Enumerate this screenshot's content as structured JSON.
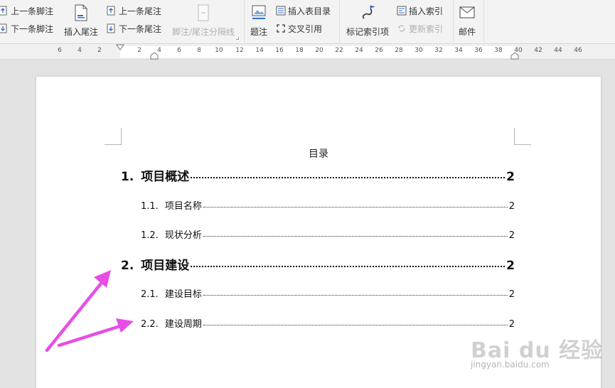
{
  "ribbon": {
    "footnote_prev": "上一条脚注",
    "footnote_next": "下一条脚注",
    "insert_endnote": "插入尾注",
    "endnote_prev": "上一条尾注",
    "endnote_next": "下一条尾注",
    "separator": "脚注/尾注分隔线",
    "caption": "题注",
    "insert_table_of_figures": "插入表目录",
    "cross_reference": "交叉引用",
    "mark_index_entry": "标记索引项",
    "insert_index": "插入索引",
    "update_index": "更新索引",
    "mail": "邮件"
  },
  "ruler": {
    "ticks": [
      "6",
      "4",
      "2",
      "2",
      "4",
      "6",
      "8",
      "10",
      "12",
      "14",
      "16",
      "18",
      "20",
      "22",
      "24",
      "26",
      "28",
      "30",
      "32",
      "34",
      "36",
      "38",
      "40",
      "42",
      "44",
      "46"
    ]
  },
  "document": {
    "toc_title": "目录",
    "entries": [
      {
        "number": "1.",
        "text": "项目概述",
        "page": "2",
        "level": 1
      },
      {
        "number": "1.1.",
        "text": "项目名称",
        "page": "2",
        "level": 2
      },
      {
        "number": "1.2.",
        "text": "现状分析",
        "page": "2",
        "level": 2
      },
      {
        "number": "2.",
        "text": "项目建设",
        "page": "2",
        "level": 1
      },
      {
        "number": "2.1.",
        "text": "建设目标",
        "page": "2",
        "level": 2
      },
      {
        "number": "2.2.",
        "text": "建设周期",
        "page": "2",
        "level": 2
      }
    ]
  },
  "annotation": {
    "arrow_color": "#e64ee6"
  },
  "watermark": {
    "logo": "Bai du 经验",
    "url": "jingyan.baidu.com"
  },
  "colors": {
    "ribbon_bg": "#f3f3f3",
    "page_bg": "#ffffff",
    "workspace_bg": "#e3e3e3",
    "icon_blue": "#2f6fd0"
  }
}
